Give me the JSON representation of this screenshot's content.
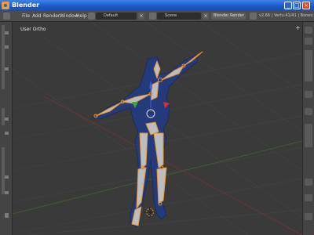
{
  "window": {
    "title": "Blender"
  },
  "menus": [
    "File",
    "Add",
    "Render",
    "Window",
    "Help"
  ],
  "screen_layout": {
    "value": "Default"
  },
  "scene": {
    "value": "Scene"
  },
  "render_engine": {
    "value": "Blender Render"
  },
  "stats": {
    "text": "v2.66 | Verts:41/41 | Bones:20/20"
  },
  "viewport": {
    "label": "User Ortho",
    "add_icon": "+"
  },
  "colors": {
    "bone": "#b9b9b9",
    "bone_outline": "#e8922c",
    "mesh": "#243a7a",
    "grid": "#444444",
    "x_axis": "#8a3535",
    "y_axis": "#3e7a2e"
  }
}
